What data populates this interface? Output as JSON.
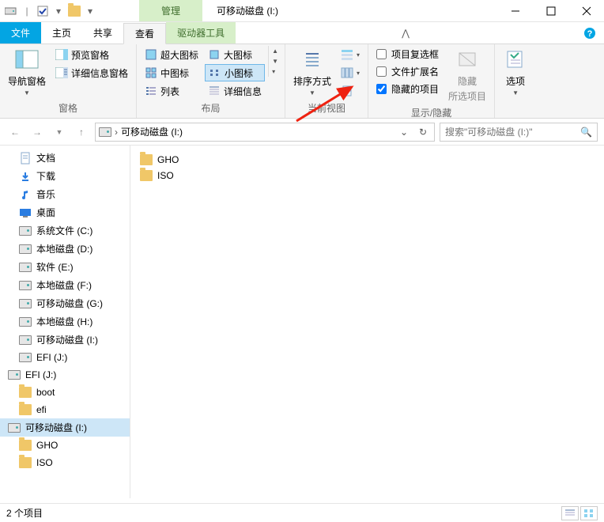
{
  "titlebar": {
    "context_tab": "管理",
    "title": "可移动磁盘 (I:)"
  },
  "tabs": {
    "file": "文件",
    "home": "主页",
    "share": "共享",
    "view": "查看",
    "driver": "驱动器工具"
  },
  "ribbon": {
    "panes": {
      "nav_pane": "导航窗格",
      "preview_pane": "预览窗格",
      "details_pane": "详细信息窗格",
      "group_label": "窗格"
    },
    "layout": {
      "extra_large": "超大图标",
      "large": "大图标",
      "medium": "中图标",
      "small": "小图标",
      "list": "列表",
      "details": "详细信息",
      "group_label": "布局"
    },
    "current_view": {
      "sort_by": "排序方式",
      "group_label": "当前视图"
    },
    "show_hide": {
      "checkboxes": "项目复选框",
      "extensions": "文件扩展名",
      "hidden_items": "隐藏的项目",
      "hide_btn": "隐藏",
      "hide_sub": "所选项目",
      "group_label": "显示/隐藏"
    },
    "options": {
      "label": "选项"
    }
  },
  "nav": {
    "address": "可移动磁盘 (I:)",
    "search_placeholder": "搜索\"可移动磁盘 (I:)\""
  },
  "tree": [
    {
      "icon": "doc",
      "label": "文档",
      "indent": 1
    },
    {
      "icon": "download",
      "label": "下载",
      "indent": 1
    },
    {
      "icon": "music",
      "label": "音乐",
      "indent": 1
    },
    {
      "icon": "desktop",
      "label": "桌面",
      "indent": 1
    },
    {
      "icon": "drive",
      "label": "系统文件 (C:)",
      "indent": 1
    },
    {
      "icon": "drive",
      "label": "本地磁盘 (D:)",
      "indent": 1
    },
    {
      "icon": "drive",
      "label": "软件 (E:)",
      "indent": 1
    },
    {
      "icon": "drive",
      "label": "本地磁盘 (F:)",
      "indent": 1
    },
    {
      "icon": "drive",
      "label": "可移动磁盘 (G:)",
      "indent": 1
    },
    {
      "icon": "drive",
      "label": "本地磁盘 (H:)",
      "indent": 1
    },
    {
      "icon": "drive",
      "label": "可移动磁盘 (I:)",
      "indent": 1
    },
    {
      "icon": "drive",
      "label": "EFI (J:)",
      "indent": 1
    },
    {
      "icon": "drive",
      "label": "EFI (J:)",
      "indent": 0,
      "expanded": true
    },
    {
      "icon": "folder",
      "label": "boot",
      "indent": 1
    },
    {
      "icon": "folder",
      "label": "efi",
      "indent": 1
    },
    {
      "icon": "drive",
      "label": "可移动磁盘 (I:)",
      "indent": 0,
      "selected": true
    },
    {
      "icon": "folder",
      "label": "GHO",
      "indent": 1
    },
    {
      "icon": "folder",
      "label": "ISO",
      "indent": 1
    }
  ],
  "files": [
    {
      "name": "GHO"
    },
    {
      "name": "ISO"
    }
  ],
  "status": {
    "count": "2 个项目"
  }
}
